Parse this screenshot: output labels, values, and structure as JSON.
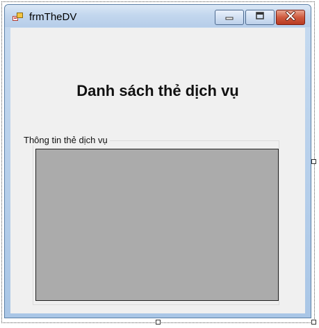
{
  "window": {
    "title": "frmTheDV",
    "icon": "form-icon",
    "controls": [
      "minimize-icon",
      "maximize-icon",
      "close-icon"
    ]
  },
  "main": {
    "heading": "Danh sách thẻ dịch vụ",
    "group": {
      "label": "Thông tin thẻ dịch vụ"
    }
  },
  "colors": {
    "client_bg": "#f0f0f0",
    "grid_bg": "#ababab",
    "close_button": "#c94a30"
  }
}
